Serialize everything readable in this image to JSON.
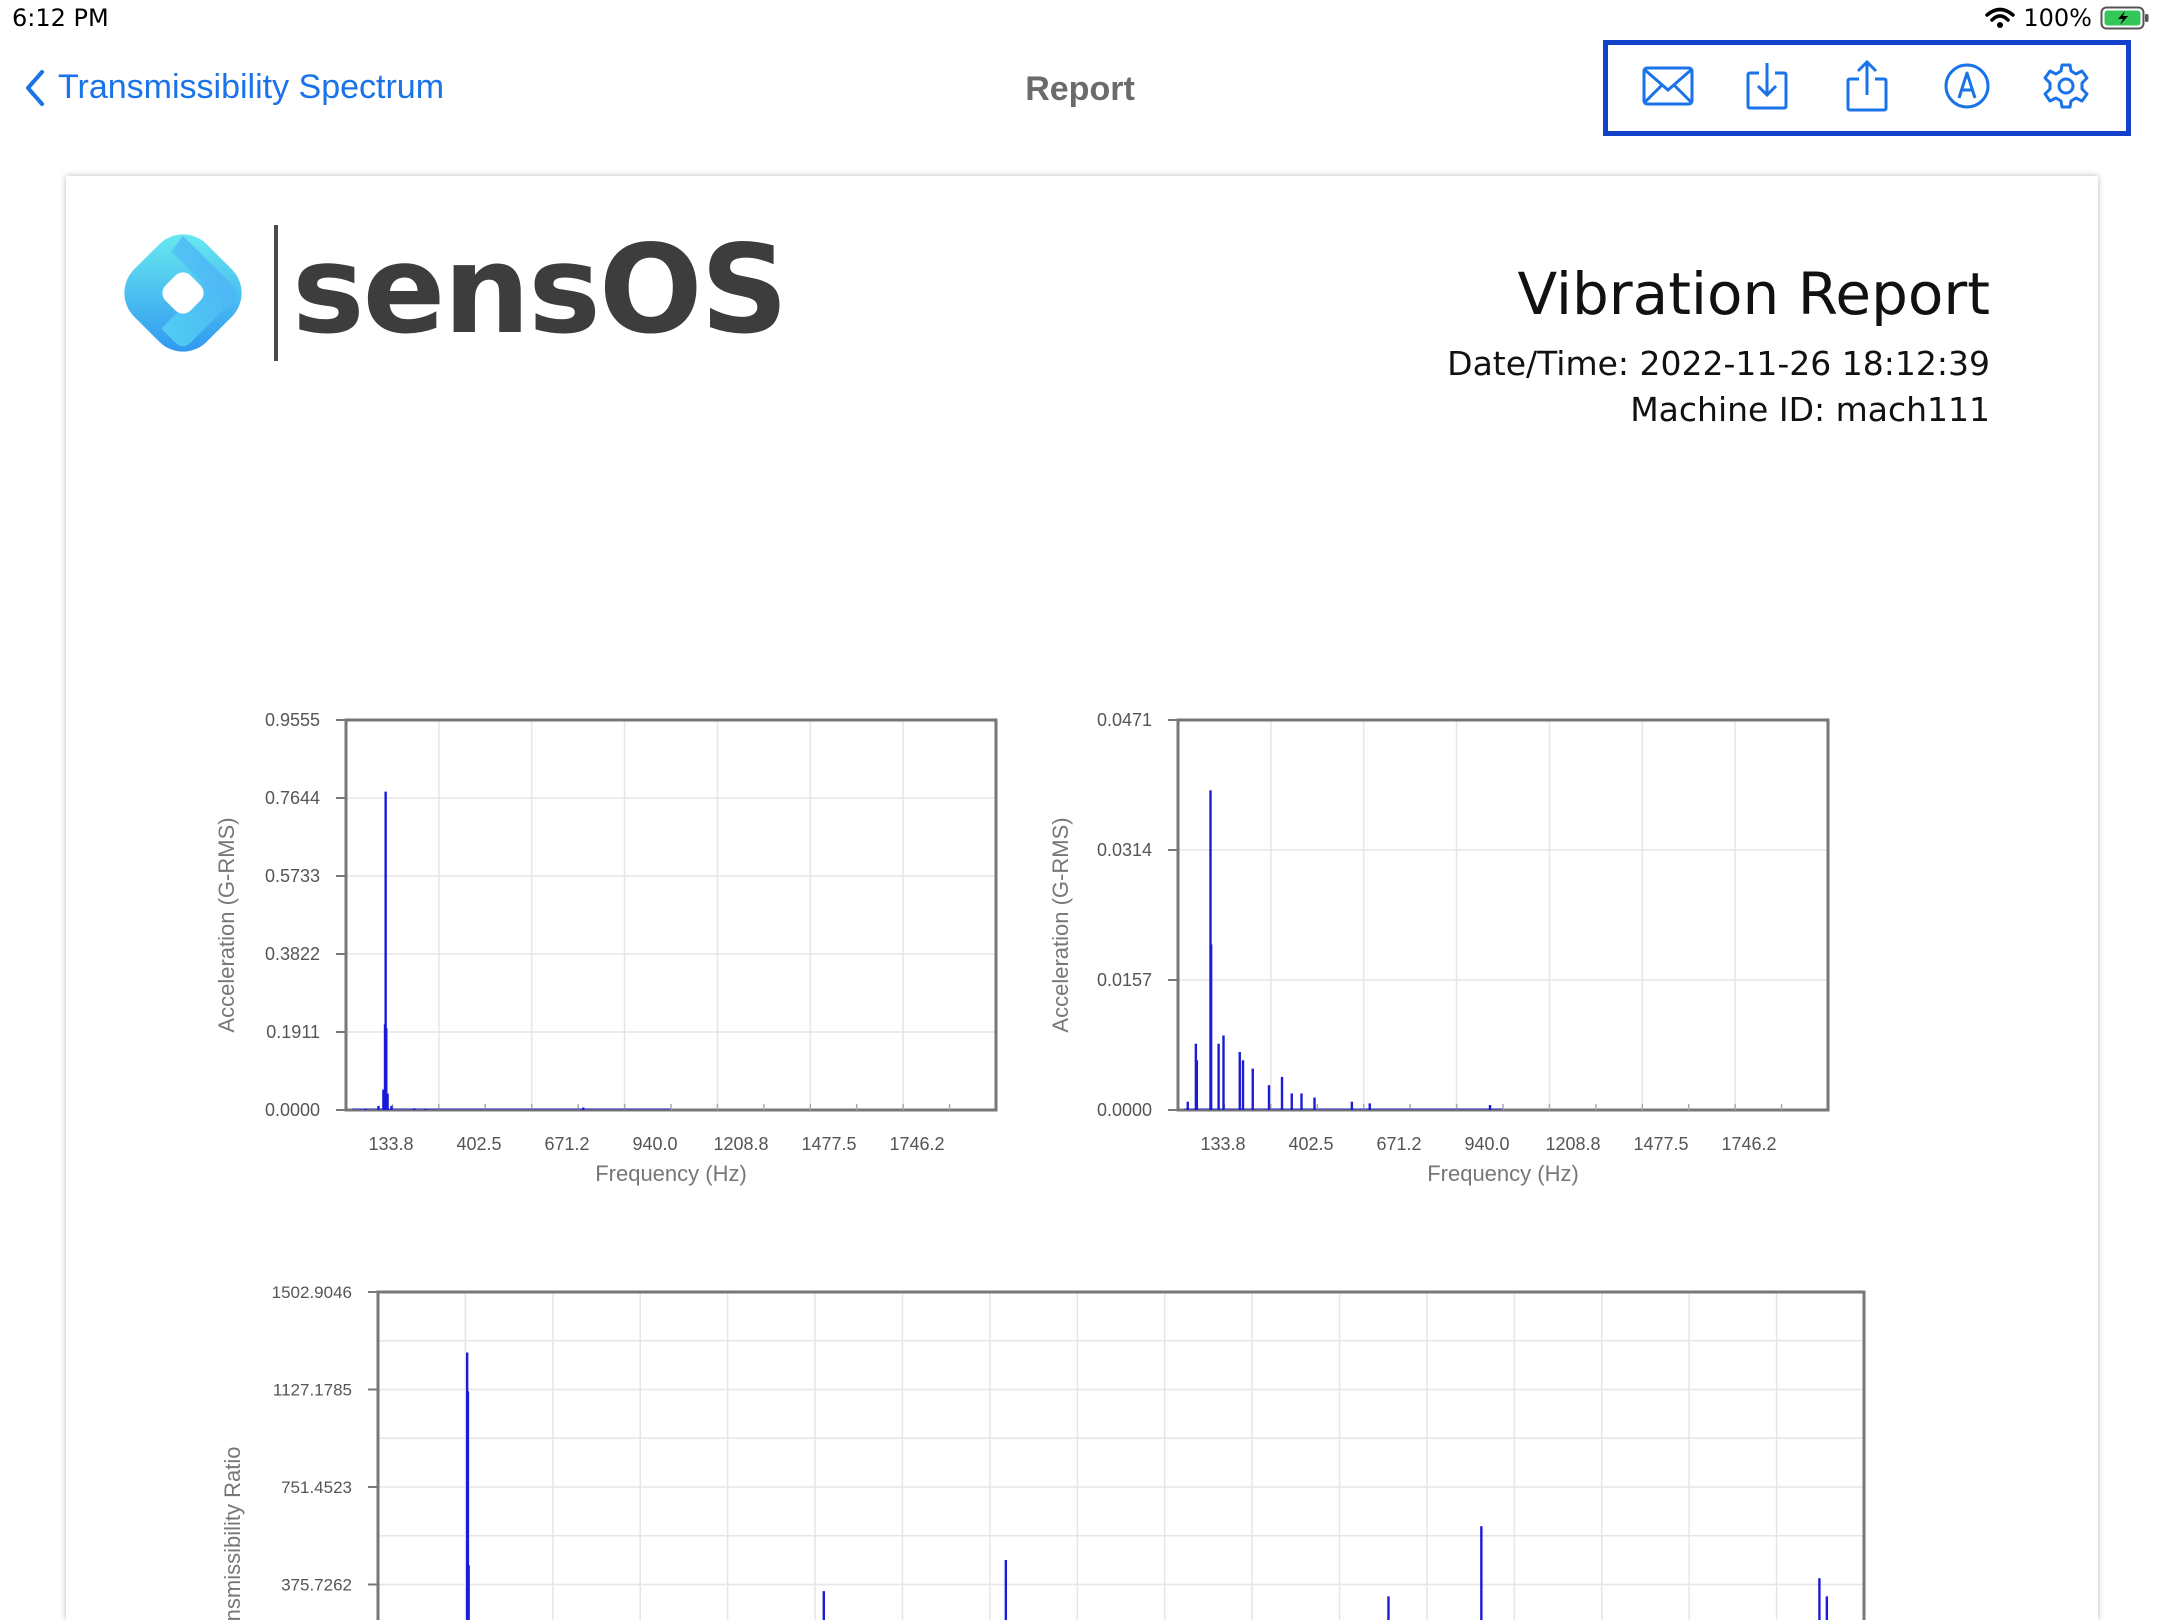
{
  "status_bar": {
    "time": "6:12 PM",
    "battery_percent": "100%"
  },
  "nav": {
    "back_label": "Transmissibility Spectrum",
    "title": "Report",
    "toolbar_icons": [
      "mail-icon",
      "download-icon",
      "share-icon",
      "markup-icon",
      "gear-icon"
    ]
  },
  "report": {
    "brand": "sensOS",
    "title": "Vibration Report",
    "datetime": "Date/Time: 2022-11-26 18:12:39",
    "machine_id": "Machine ID: mach111"
  },
  "colors": {
    "accent": "#1a73e8",
    "highlight_border": "#1340c9",
    "series": "#1b1bd6",
    "grid": "#e6e6e6",
    "frame": "#777777"
  },
  "chart_data": [
    {
      "type": "line",
      "xlabel": "Frequency (Hz)",
      "ylabel": "Acceleration (G-RMS)",
      "xticks": [
        "133.8",
        "402.5",
        "671.2",
        "940.0",
        "1208.8",
        "1477.5",
        "1746.2"
      ],
      "yticks": [
        "0.0000",
        "0.1911",
        "0.3822",
        "0.5733",
        "0.7644",
        "0.9555"
      ],
      "xlim": [
        0,
        2000
      ],
      "ylim": [
        0,
        0.9555
      ],
      "grid": true,
      "series": [
        {
          "points": [
            [
              60,
              0.003
            ],
            [
              100,
              0.01
            ],
            [
              115,
              0.05
            ],
            [
              120,
              0.21
            ],
            [
              122,
              0.78
            ],
            [
              124,
              0.2
            ],
            [
              128,
              0.04
            ],
            [
              140,
              0.01
            ],
            [
              210,
              0.004
            ],
            [
              245,
              0.003
            ],
            [
              730,
              0.006
            ]
          ]
        }
      ]
    },
    {
      "type": "line",
      "xlabel": "Frequency (Hz)",
      "ylabel": "Acceleration (G-RMS)",
      "xticks": [
        "133.8",
        "402.5",
        "671.2",
        "940.0",
        "1208.8",
        "1477.5",
        "1746.2"
      ],
      "yticks": [
        "0.0000",
        "0.0157",
        "0.0314",
        "0.0471"
      ],
      "xlim": [
        0,
        2000
      ],
      "ylim": [
        0,
        0.0471
      ],
      "grid": true,
      "series": [
        {
          "points": [
            [
              30,
              0.001
            ],
            [
              55,
              0.008
            ],
            [
              58,
              0.006
            ],
            [
              100,
              0.0386
            ],
            [
              102,
              0.02
            ],
            [
              125,
              0.008
            ],
            [
              140,
              0.009
            ],
            [
              190,
              0.007
            ],
            [
              200,
              0.006
            ],
            [
              230,
              0.005
            ],
            [
              280,
              0.003
            ],
            [
              320,
              0.004
            ],
            [
              350,
              0.002
            ],
            [
              380,
              0.002
            ],
            [
              420,
              0.0015
            ],
            [
              535,
              0.001
            ],
            [
              590,
              0.0008
            ],
            [
              960,
              0.0006
            ]
          ]
        }
      ]
    },
    {
      "type": "line",
      "ylabel": "Transmissibility Ratio",
      "yticks": [
        "375.7262",
        "751.4523",
        "1127.1785",
        "1502.9046"
      ],
      "xlim": [
        0,
        2000
      ],
      "ylim": [
        0,
        1502.9046
      ],
      "grid": true,
      "series": [
        {
          "points": [
            [
              120,
              1270
            ],
            [
              121,
              1120
            ],
            [
              122,
              450
            ],
            [
              600,
              350
            ],
            [
              845,
              470
            ],
            [
              1360,
              330
            ],
            [
              1485,
              600
            ],
            [
              1940,
              400
            ],
            [
              1950,
              330
            ]
          ]
        }
      ]
    }
  ]
}
